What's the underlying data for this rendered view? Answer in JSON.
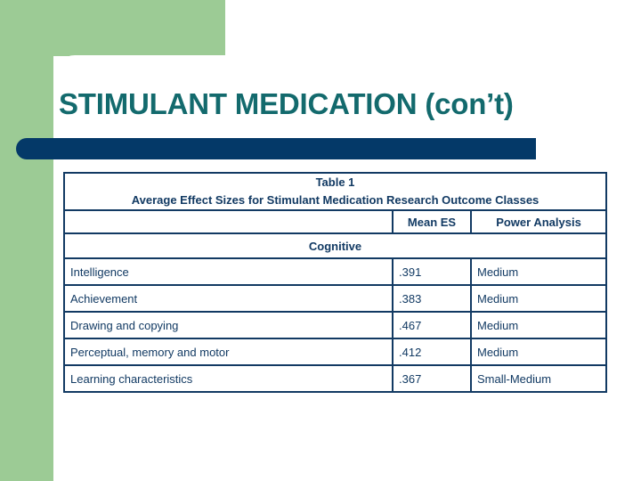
{
  "slide": {
    "title": "STIMULANT MEDICATION (con’t)",
    "theme": {
      "accent_green": "#9ccb95",
      "accent_navy": "#043968",
      "title_teal": "#136a6d",
      "table_ink": "#123a63",
      "background": "#ffffff"
    }
  },
  "table": {
    "caption_line1": "Table 1",
    "caption_line2": "Average Effect Sizes for Stimulant Medication Research Outcome Classes",
    "blank_header": "",
    "columns": [
      "",
      "Mean ES",
      "Power Analysis"
    ],
    "sections": [
      {
        "name": "Cognitive",
        "rows": [
          {
            "label": "Intelligence",
            "mean_es": ".391",
            "power_analysis": "Medium"
          },
          {
            "label": "Achievement",
            "mean_es": ".383",
            "power_analysis": "Medium"
          },
          {
            "label": "Drawing and copying",
            "mean_es": ".467",
            "power_analysis": "Medium"
          },
          {
            "label": "Perceptual, memory and motor",
            "mean_es": ".412",
            "power_analysis": "Medium"
          },
          {
            "label": "Learning characteristics",
            "mean_es": ".367",
            "power_analysis": "Small-Medium"
          }
        ]
      }
    ]
  }
}
